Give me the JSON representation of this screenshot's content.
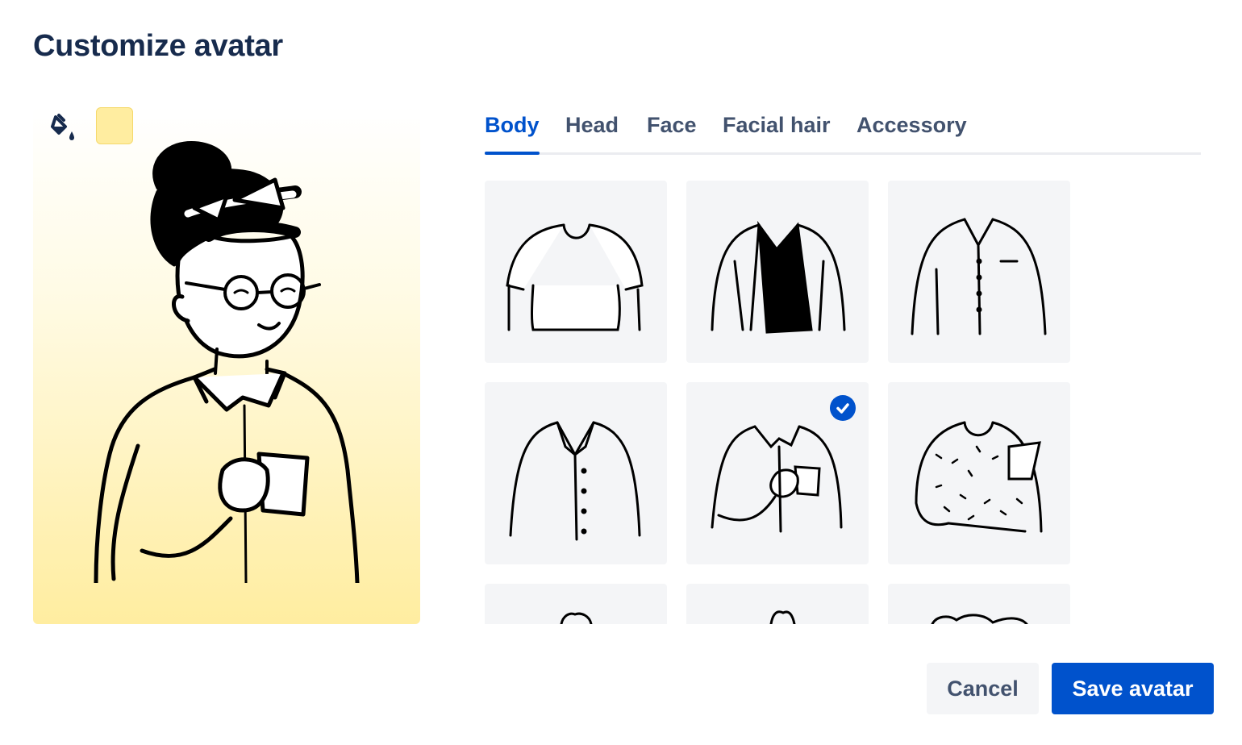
{
  "dialog": {
    "title": "Customize avatar"
  },
  "preview": {
    "background_color": "#FFEDA0",
    "paint_icon": "paint-bucket-icon"
  },
  "tabs": [
    {
      "label": "Body",
      "active": true
    },
    {
      "label": "Head",
      "active": false
    },
    {
      "label": "Face",
      "active": false
    },
    {
      "label": "Facial hair",
      "active": false
    },
    {
      "label": "Accessory",
      "active": false
    }
  ],
  "body_options": [
    {
      "name": "t-shirt",
      "selected": false
    },
    {
      "name": "open-jacket-v-neck",
      "selected": false
    },
    {
      "name": "button-up-shirt-pocket",
      "selected": false
    },
    {
      "name": "collared-shirt",
      "selected": false
    },
    {
      "name": "shirt-holding-mug",
      "selected": true
    },
    {
      "name": "patterned-top-holding-phone",
      "selected": false
    },
    {
      "name": "option-7",
      "selected": false
    },
    {
      "name": "option-8",
      "selected": false
    },
    {
      "name": "option-9",
      "selected": false
    }
  ],
  "selected_icon": "checkmark-icon",
  "actions": {
    "cancel_label": "Cancel",
    "save_label": "Save avatar"
  },
  "colors": {
    "primary": "#0052CC",
    "title_text": "#172B4D",
    "tab_text": "#42526E",
    "tile_background": "#F4F5F7",
    "swatch": "#FFEDA0"
  }
}
